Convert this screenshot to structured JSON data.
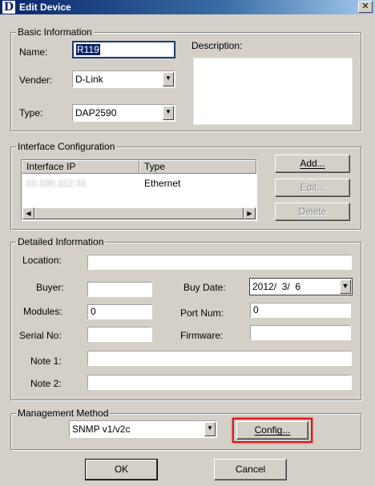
{
  "window": {
    "logo_letter": "D",
    "title": "Edit Device",
    "close_glyph": "✕"
  },
  "basic_info": {
    "legend": "Basic Information",
    "name_label": "Name:",
    "name_value": "R119",
    "vendor_label": "Vender:",
    "vendor_value": "D-Link",
    "type_label": "Type:",
    "type_value": "DAP2590",
    "description_label": "Description:",
    "description_value": ""
  },
  "interface_config": {
    "legend": "Interface Configuration",
    "columns": [
      "Interface IP",
      "Type"
    ],
    "rows": [
      {
        "ip": "10.100.112.31",
        "type": "Ethernet"
      }
    ],
    "add_label": "Add...",
    "edit_label": "Edit...",
    "delete_label": "Delete"
  },
  "detailed_info": {
    "legend": "Detailed Information",
    "location_label": "Location:",
    "location_value": "",
    "buyer_label": "Buyer:",
    "buyer_value": "",
    "buy_date_label": "Buy Date:",
    "buy_date_value": "2012/  3/  6",
    "modules_label": "Modules:",
    "modules_value": "0",
    "port_num_label": "Port Num:",
    "port_num_value": "0",
    "serial_label": "Serial No:",
    "serial_value": "",
    "firmware_label": "Firmware:",
    "firmware_value": "",
    "note1_label": "Note 1:",
    "note1_value": "",
    "note2_label": "Note 2:",
    "note2_value": ""
  },
  "management": {
    "legend": "Management Method",
    "method_value": "SNMP v1/v2c",
    "config_label": "Config..."
  },
  "footer": {
    "ok_label": "OK",
    "cancel_label": "Cancel"
  },
  "colors": {
    "dialog_bg": "#d4d0c8",
    "title_gradient_start": "#0a246a",
    "highlight_red": "#e0141c"
  }
}
